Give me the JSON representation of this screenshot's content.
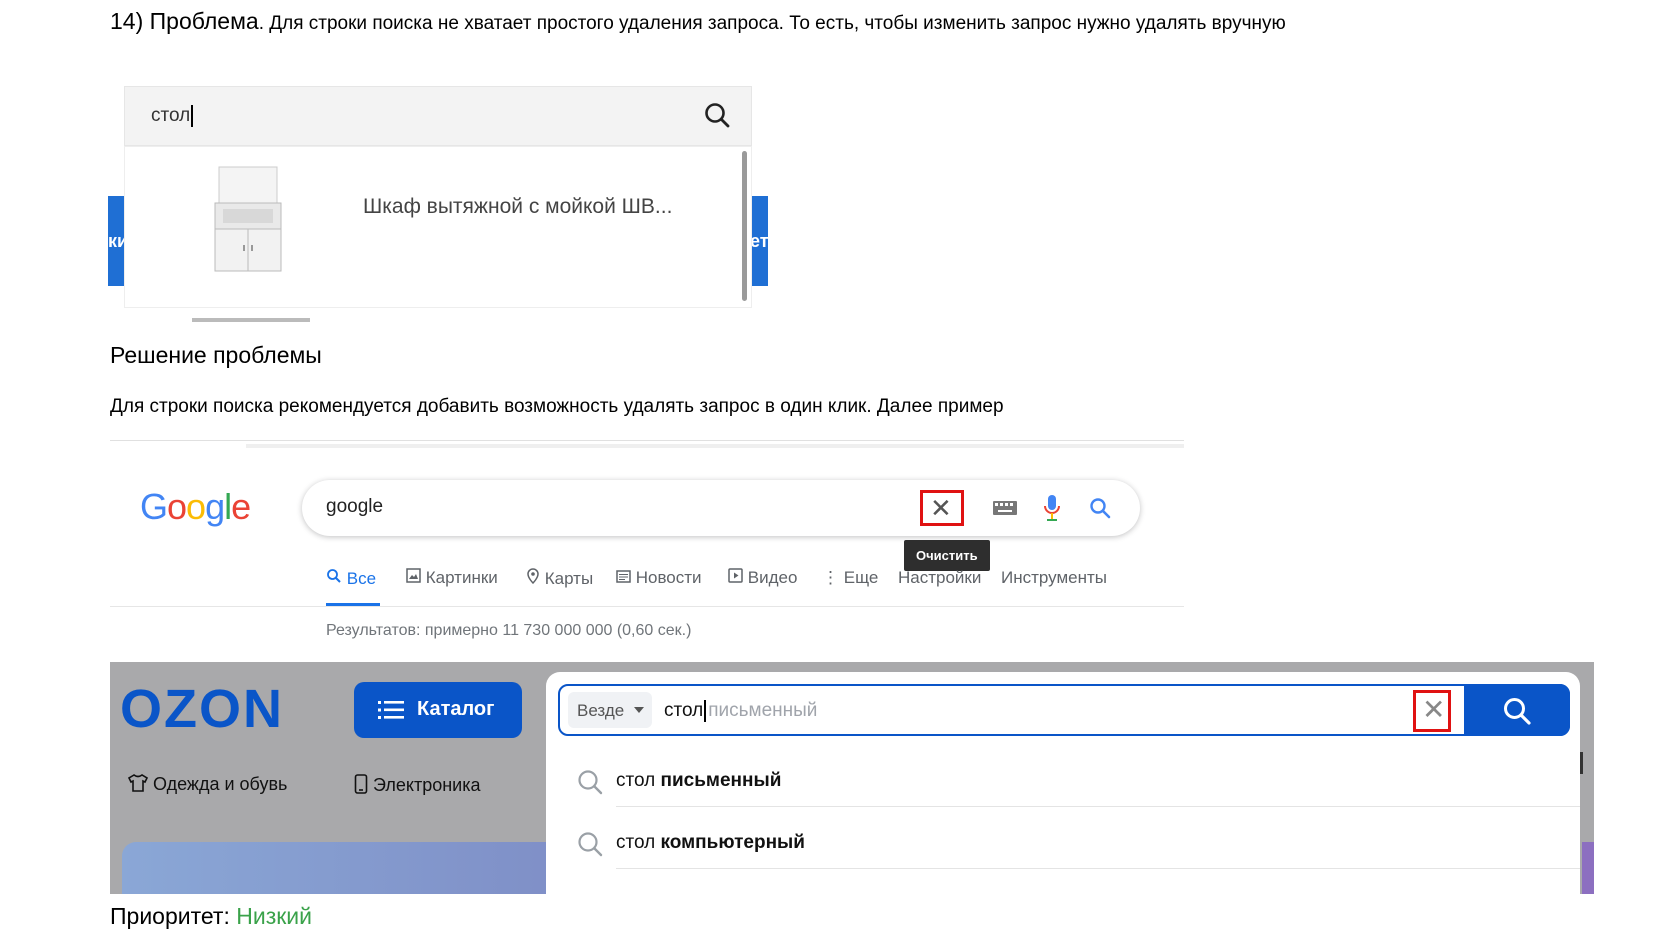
{
  "doc": {
    "problem_heading": "14) Проблема",
    "problem_desc": ". Для строки поиска не хватает простого удаления запроса. То есть, чтобы изменить запрос нужно удалять вручную",
    "solution_heading": "Решение проблемы",
    "solution_text": "Для строки поиска рекомендуется добавить возможность удалять запрос в один клик. Далее пример",
    "priority_label": "Приоритет: ",
    "priority_value": "Низкий"
  },
  "shop": {
    "query": "стол",
    "left_bar_text": "ки",
    "right_bar_text": "ет",
    "product_name": "Шкаф вытяжной с мойкой ШВ...",
    "icon": "search-icon"
  },
  "google": {
    "logo": "Google",
    "query": "google",
    "tooltip": "Очистить",
    "tabs": [
      {
        "label": "Все"
      },
      {
        "label": "Картинки"
      },
      {
        "label": "Карты"
      },
      {
        "label": "Новости"
      },
      {
        "label": "Видео"
      },
      {
        "label": "Еще"
      },
      {
        "label": "Настройки"
      },
      {
        "label": "Инструменты"
      }
    ],
    "results": "Результатов: примерно 11 730 000 000 (0,60 сек.)",
    "accent": "#1a73e8"
  },
  "ozon": {
    "logo": "OZON",
    "catalog": "Каталог",
    "cat1": "Одежда и обувь",
    "cat2": "Электроника",
    "scope": "Везде",
    "typed": "стол",
    "suggested": "письменный",
    "suggestions": [
      {
        "base": "стол",
        "rest": "письменный"
      },
      {
        "base": "стол",
        "rest": "компьютерный"
      }
    ],
    "brand": "#0a55c8"
  },
  "highlight_color": "#e01212"
}
